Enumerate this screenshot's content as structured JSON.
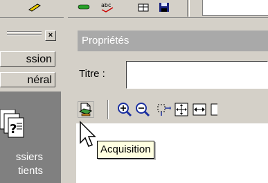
{
  "left_panel": {
    "buttons": [
      {
        "label": "ssion"
      },
      {
        "label": "néral"
      }
    ],
    "item_lines": [
      "ssiers",
      "tients"
    ]
  },
  "properties": {
    "header": "Propriétés",
    "title_label": "Titre :",
    "title_value": ""
  },
  "toolbar": {
    "tools": [
      {
        "icon": "acquisition-icon"
      },
      {
        "icon": "zoom-in-icon"
      },
      {
        "icon": "zoom-out-icon"
      },
      {
        "icon": "select-region-icon"
      },
      {
        "icon": "fit-page-icon"
      },
      {
        "icon": "fit-width-icon"
      }
    ]
  },
  "tooltip": {
    "text": "Acquisition"
  },
  "colors": {
    "window_bg": "#d4d0c8",
    "header_bg": "#a9a9a9",
    "well_bg": "#808080",
    "tooltip_bg": "#ffffe1",
    "zoom_blue": "#1a2fa0"
  }
}
